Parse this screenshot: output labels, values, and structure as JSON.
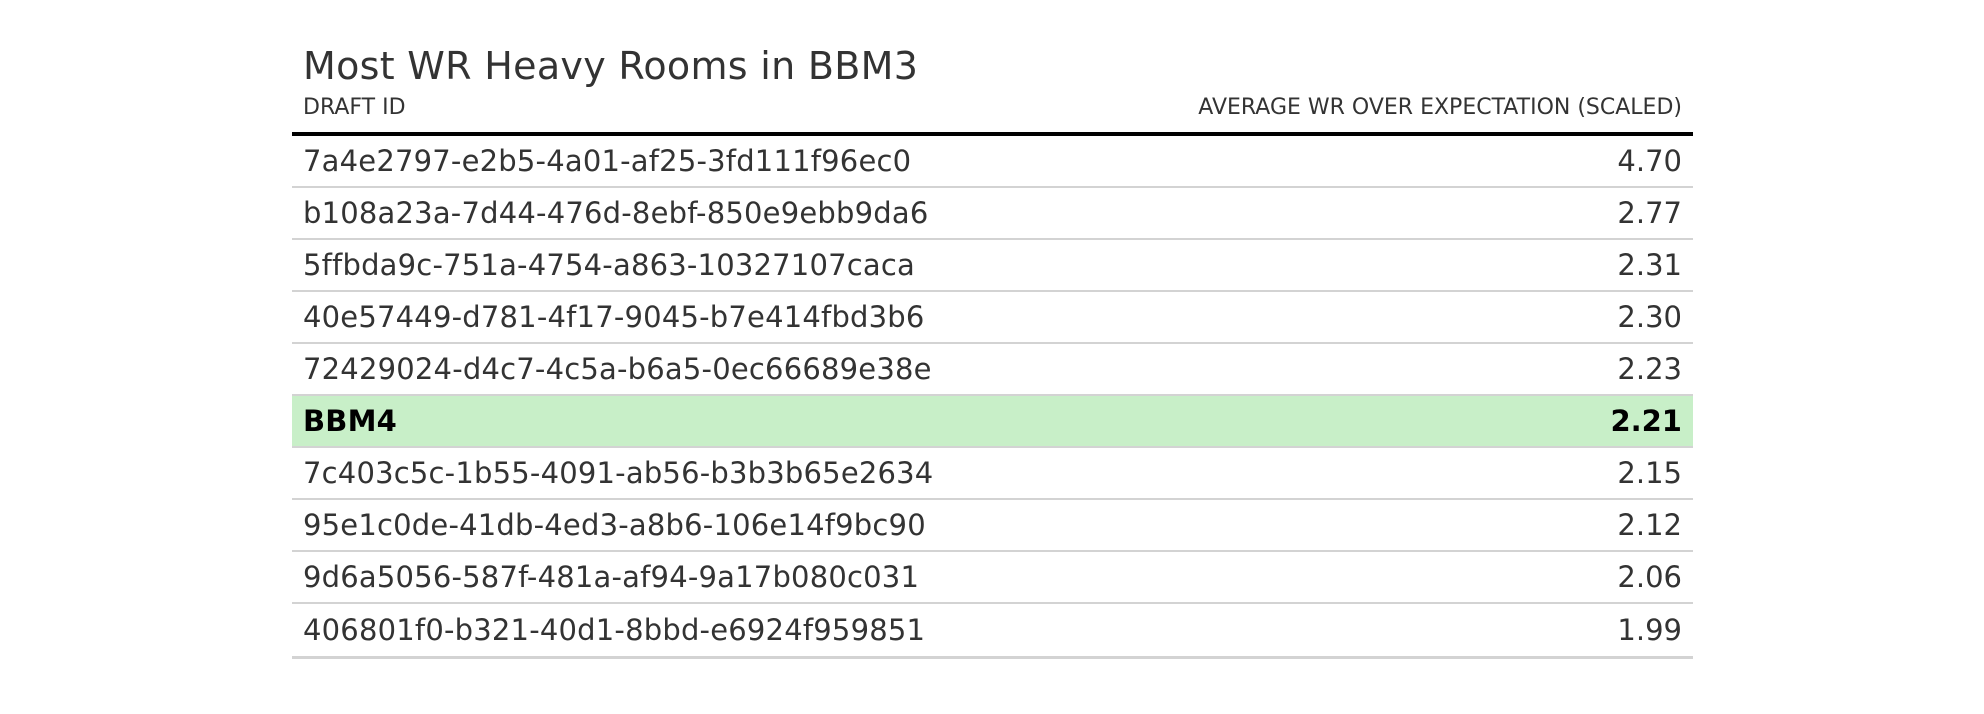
{
  "colors": {
    "highlight_background": "#c8efc8",
    "header_rule": "#000000",
    "row_rule": "#d3d3d3",
    "text": "#333333"
  },
  "chart_data": {
    "type": "table",
    "title": "Most WR Heavy Rooms in BBM3",
    "columns": [
      "DRAFT ID",
      "AVERAGE WR OVER EXPECTATION (SCALED)"
    ],
    "rows": [
      {
        "draft_id": "7a4e2797-e2b5-4a01-af25-3fd111f96ec0",
        "value": "4.70",
        "highlight": false
      },
      {
        "draft_id": "b108a23a-7d44-476d-8ebf-850e9ebb9da6",
        "value": "2.77",
        "highlight": false
      },
      {
        "draft_id": "5ffbda9c-751a-4754-a863-10327107caca",
        "value": "2.31",
        "highlight": false
      },
      {
        "draft_id": "40e57449-d781-4f17-9045-b7e414fbd3b6",
        "value": "2.30",
        "highlight": false
      },
      {
        "draft_id": "72429024-d4c7-4c5a-b6a5-0ec66689e38e",
        "value": "2.23",
        "highlight": false
      },
      {
        "draft_id": "BBM4",
        "value": "2.21",
        "highlight": true
      },
      {
        "draft_id": "7c403c5c-1b55-4091-ab56-b3b3b65e2634",
        "value": "2.15",
        "highlight": false
      },
      {
        "draft_id": "95e1c0de-41db-4ed3-a8b6-106e14f9bc90",
        "value": "2.12",
        "highlight": false
      },
      {
        "draft_id": "9d6a5056-587f-481a-af94-9a17b080c031",
        "value": "2.06",
        "highlight": false
      },
      {
        "draft_id": "406801f0-b321-40d1-8bbd-e6924f959851",
        "value": "1.99",
        "highlight": false
      }
    ]
  }
}
